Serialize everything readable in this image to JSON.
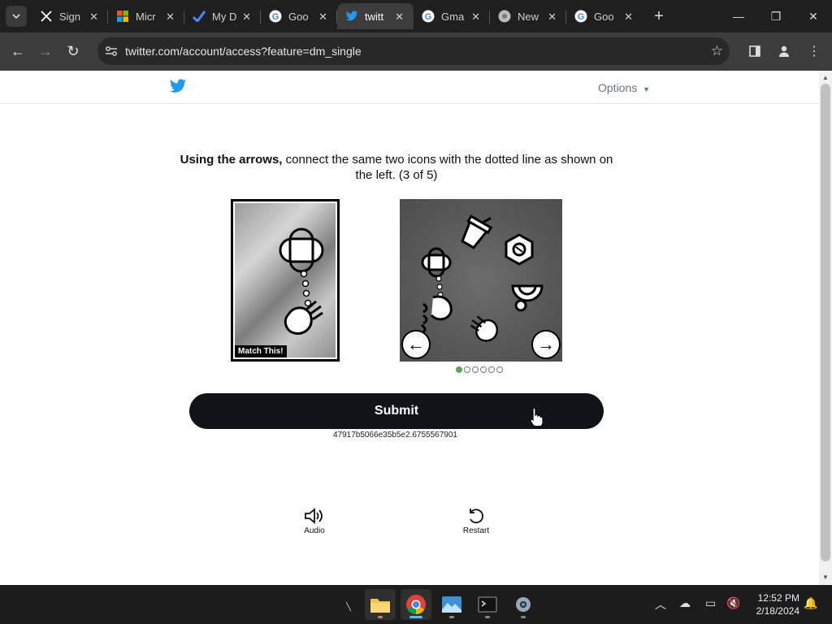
{
  "browser": {
    "tabs": [
      {
        "title": "Sign",
        "icon": "x-icon"
      },
      {
        "title": "Micr",
        "icon": "microsoft-icon"
      },
      {
        "title": "My D",
        "icon": "check-icon"
      },
      {
        "title": "Goo",
        "icon": "google-icon"
      },
      {
        "title": "twitt",
        "icon": "twitter-icon",
        "active": true
      },
      {
        "title": "Gma",
        "icon": "google-icon"
      },
      {
        "title": "New",
        "icon": "chrome-icon"
      },
      {
        "title": "Goo",
        "icon": "google-icon"
      }
    ],
    "url_host": "twitter.com",
    "url_path": "/account/access?feature=dm_single"
  },
  "header": {
    "options_label": "Options"
  },
  "challenge": {
    "instruction_bold": "Using the arrows,",
    "instruction_rest": " connect the same two icons with the dotted line as shown on the left. (3 of 5)",
    "match_label": "Match This!",
    "page_dots": 6,
    "active_dot": 0,
    "submit_label": "Submit",
    "session_id": "47917b5066e35b5e2.6755567901",
    "audio_label": "Audio",
    "restart_label": "Restart"
  },
  "taskbar": {
    "time": "12:52 PM",
    "date": "2/18/2024"
  },
  "colors": {
    "twitter_blue": "#1d9bf0",
    "submit_bg": "#0f1419",
    "dot_active": "#5fa35f"
  }
}
